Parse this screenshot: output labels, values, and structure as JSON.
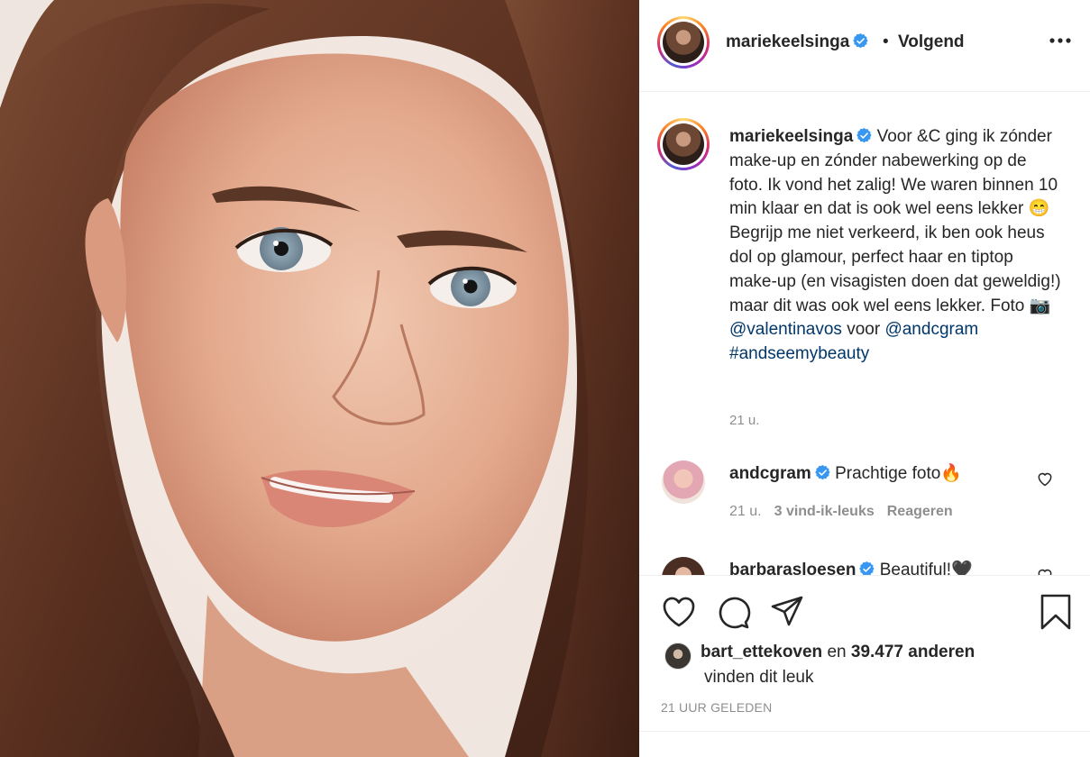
{
  "post": {
    "username": "mariekeelsinga",
    "separator": "•",
    "follow_label": "Volgend",
    "caption_body": "Voor &C ging ik zónder make-up en zónder nabewerking op de foto. Ik vond het zalig! We waren binnen 10 min klaar en dat is ook wel eens lekker 😁 Begrijp me niet verkeerd, ik ben ook heus dol op glamour, perfect haar en tiptop make-up (en visagisten doen dat geweldig!) maar dit was ook wel eens lekker. Foto 📷 ",
    "mention_photographer": "@valentinavos",
    "caption_voor": "voor ",
    "mention_brand": "@andcgram",
    "hashtag": "#andseemybeauty",
    "caption_time": "21 u."
  },
  "comments": [
    {
      "username": "andcgram",
      "text": "Prachtige foto🔥",
      "time": "21 u.",
      "likes": "3 vind-ik-leuks",
      "reply": "Reageren"
    },
    {
      "username": "barbarasloesen",
      "text": "Beautiful!🖤"
    }
  ],
  "likes": {
    "first_user": "bart_ettekoven",
    "and_word": " en ",
    "others": "39.477 anderen",
    "line2": "vinden dit leuk"
  },
  "timestamp": "21 UUR GELEDEN",
  "icons": {
    "like": "heart-outline-icon",
    "comment": "speech-bubble-icon",
    "share": "paper-plane-icon",
    "save": "bookmark-icon",
    "more": "ellipsis-icon",
    "verified": "verified-badge-icon"
  },
  "colors": {
    "text": "#262626",
    "muted": "#8e8e8e",
    "link": "#00376b",
    "verified": "#3897f0",
    "divider": "#efefef"
  }
}
